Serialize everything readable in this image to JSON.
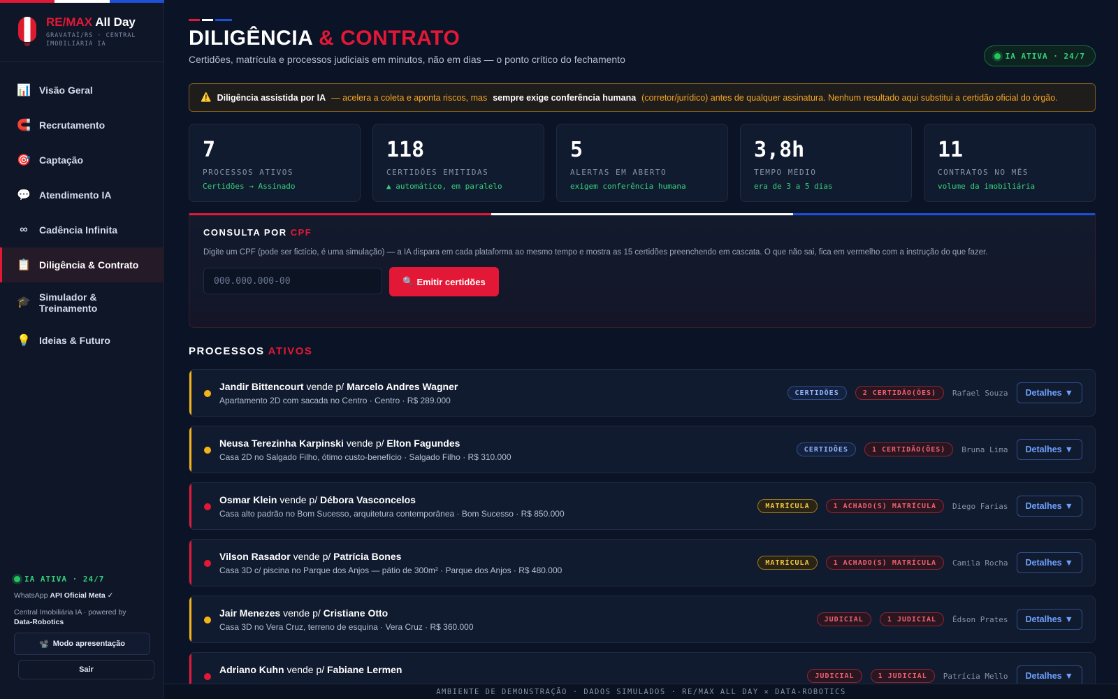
{
  "colors": {
    "accent_red": "#e31837",
    "brand_blue": "#1e4fd6",
    "status_green": "#22c55e",
    "warning_amber": "#f5a623",
    "background": "#0b1326"
  },
  "brand": {
    "title_red": "RE/MAX",
    "title_white": "All Day",
    "subtitle": "GRAVATAÍ/RS · CENTRAL IMOBILIÁRIA IA",
    "logo_icon": "hot-air-balloon-icon"
  },
  "nav": {
    "items": [
      {
        "label": "Visão Geral",
        "icon": "📊",
        "icon_name": "bar-chart-icon"
      },
      {
        "label": "Recrutamento",
        "icon": "🧲",
        "icon_name": "magnet-icon"
      },
      {
        "label": "Captação",
        "icon": "🎯",
        "icon_name": "target-icon"
      },
      {
        "label": "Atendimento IA",
        "icon": "💬",
        "icon_name": "chat-icon"
      },
      {
        "label": "Cadência Infinita",
        "icon": "∞",
        "icon_name": "infinity-icon"
      },
      {
        "label": "Diligência & Contrato",
        "icon": "📋",
        "icon_name": "clipboard-icon"
      },
      {
        "label": "Simulador & Treinamento",
        "icon": "🎓",
        "icon_name": "graduation-cap-icon"
      },
      {
        "label": "Ideias & Futuro",
        "icon": "💡",
        "icon_name": "lightbulb-icon"
      }
    ],
    "active_index": 5
  },
  "sidebar_footer": {
    "ia_status": "IA ATIVA · 24/7",
    "whatsapp_prefix": "WhatsApp",
    "whatsapp_bold": "API Oficial Meta ✓",
    "powered_prefix": "Central Imobiliária IA · powered by",
    "powered_bold": "Data-Robotics",
    "present_icon": "📽️",
    "present_label": "Modo apresentação",
    "logout_label": "Sair"
  },
  "header": {
    "title_white": "DILIGÊNCIA",
    "title_red": "& CONTRATO",
    "subtitle": "Certidões, matrícula e processos judiciais em minutos, não em dias — o ponto crítico do fechamento",
    "badge": "IA ATIVA · 24/7"
  },
  "warning": {
    "icon": "⚠️",
    "bold_1": "Diligência assistida por IA",
    "text_1": "— acelera a coleta e aponta riscos, mas",
    "bold_2": "sempre exige conferência humana",
    "text_2": "(corretor/jurídico) antes de qualquer assinatura. Nenhum resultado aqui substitui a certidão oficial do órgão."
  },
  "stats": [
    {
      "value": "7",
      "label": "PROCESSOS ATIVOS",
      "note": "Certidões → Assinado"
    },
    {
      "value": "118",
      "label": "CERTIDÕES EMITIDAS",
      "note": "▲ automático, em paralelo"
    },
    {
      "value": "5",
      "label": "ALERTAS EM ABERTO",
      "note": "exigem conferência humana"
    },
    {
      "value": "3,8h",
      "label": "TEMPO MÉDIO",
      "note": "era de 3 a 5 dias"
    },
    {
      "value": "11",
      "label": "CONTRATOS NO MÊS",
      "note": "volume da imobiliária"
    }
  ],
  "consulta": {
    "title_white": "CONSULTA POR",
    "title_red": "CPF",
    "description": "Digite um CPF (pode ser fictício, é uma simulação) — a IA dispara em cada plataforma ao mesmo tempo e mostra as 15 certidões preenchendo em cascata. O que não sai, fica em vermelho com a instrução do que fazer.",
    "input_placeholder": "000.000.000-00",
    "input_value": "",
    "button_icon": "🔍",
    "button_label": "Emitir certidões"
  },
  "processes_section": {
    "title_white": "PROCESSOS",
    "title_red": "ATIVOS",
    "connector": "vende p/",
    "details_label": "Detalhes",
    "details_icon": "▼"
  },
  "processes": [
    {
      "seller": "Jandir Bittencourt",
      "buyer": "Marcelo Andres Wagner",
      "description": "Apartamento 2D com sacada no Centro · Centro · R$ 289.000",
      "stage": "CERTIDÕES",
      "stage_color": "blue",
      "alert": "2 CERTIDÃO(ÕES)",
      "agent": "Rafael Souza",
      "status_color": "#f5b31a"
    },
    {
      "seller": "Neusa Terezinha Karpinski",
      "buyer": "Elton Fagundes",
      "description": "Casa 2D no Salgado Filho, ótimo custo-benefício · Salgado Filho · R$ 310.000",
      "stage": "CERTIDÕES",
      "stage_color": "blue",
      "alert": "1 CERTIDÃO(ÕES)",
      "agent": "Bruna Lima",
      "status_color": "#f5b31a"
    },
    {
      "seller": "Osmar Klein",
      "buyer": "Débora Vasconcelos",
      "description": "Casa alto padrão no Bom Sucesso, arquitetura contemporânea · Bom Sucesso · R$ 850.000",
      "stage": "MATRÍCULA",
      "stage_color": "amber",
      "alert": "1 ACHADO(S) MATRÍCULA",
      "agent": "Diego Farias",
      "status_color": "#e31837"
    },
    {
      "seller": "Vilson Rasador",
      "buyer": "Patrícia Bones",
      "description": "Casa 3D c/ piscina no Parque dos Anjos — pátio de 300m² · Parque dos Anjos · R$ 480.000",
      "stage": "MATRÍCULA",
      "stage_color": "amber",
      "alert": "1 ACHADO(S) MATRÍCULA",
      "agent": "Camila Rocha",
      "status_color": "#e31837"
    },
    {
      "seller": "Jair Menezes",
      "buyer": "Cristiane Otto",
      "description": "Casa 3D no Vera Cruz, terreno de esquina · Vera Cruz · R$ 360.000",
      "stage": "JUDICIAL",
      "stage_color": "red",
      "alert": "1 JUDICIAL",
      "agent": "Édson Prates",
      "status_color": "#f5b31a"
    },
    {
      "seller": "Adriano Kuhn",
      "buyer": "Fabiane Lermen",
      "description": "",
      "stage": "JUDICIAL",
      "stage_color": "red",
      "alert": "1 JUDICIAL",
      "agent": "Patrícia Mello",
      "status_color": "#e31837"
    }
  ],
  "footer": {
    "text": "AMBIENTE DE DEMONSTRAÇÃO · DADOS SIMULADOS · RE/MAX ALL DAY × DATA-ROBOTICS"
  }
}
